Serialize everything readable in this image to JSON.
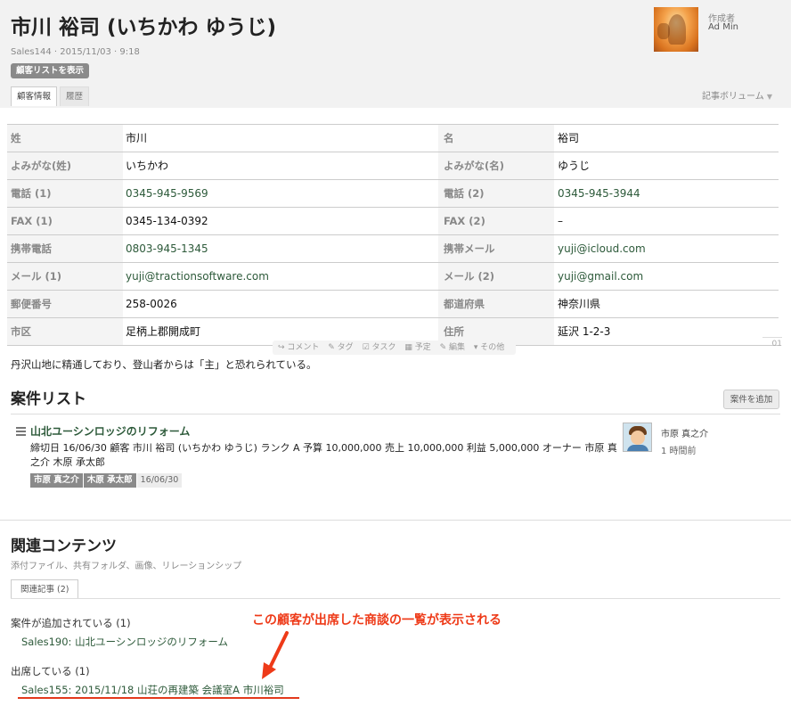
{
  "header": {
    "title": "市川 裕司 (いちかわ ゆうじ)",
    "meta": "Sales144 · 2015/11/03 · 9:18",
    "show_list_button": "顧客リストを表示",
    "author_label": "作成者",
    "author_name": "Ad Min",
    "tabs": [
      {
        "label": "顧客情報",
        "active": true
      },
      {
        "label": "履歴",
        "active": false
      }
    ],
    "volume_label": "記事ボリューム"
  },
  "fields": [
    {
      "label1": "姓",
      "value1": "市川",
      "link1": false,
      "label2": "名",
      "value2": "裕司",
      "link2": false
    },
    {
      "label1": "よみがな(姓)",
      "value1": "いちかわ",
      "link1": false,
      "label2": "よみがな(名)",
      "value2": "ゆうじ",
      "link2": false
    },
    {
      "label1": "電話 (1)",
      "value1": "0345-945-9569",
      "link1": true,
      "label2": "電話 (2)",
      "value2": "0345-945-3944",
      "link2": true
    },
    {
      "label1": "FAX (1)",
      "value1": "0345-134-0392",
      "link1": false,
      "label2": "FAX (2)",
      "value2": "–",
      "link2": false
    },
    {
      "label1": "携帯電話",
      "value1": "0803-945-1345",
      "link1": true,
      "label2": "携帯メール",
      "value2": "yuji@icloud.com",
      "link2": true
    },
    {
      "label1": "メール (1)",
      "value1": "yuji@tractionsoftware.com",
      "link1": true,
      "label2": "メール (2)",
      "value2": "yuji@gmail.com",
      "link2": true
    },
    {
      "label1": "郵便番号",
      "value1": "258-0026",
      "link1": false,
      "label2": "都道府県",
      "value2": "神奈川県",
      "link2": false
    },
    {
      "label1": "市区",
      "value1": "足柄上郡開成町",
      "link1": false,
      "label2": "住所",
      "value2": "延沢 1-2-3",
      "link2": false
    }
  ],
  "actions": {
    "comment": "↪ コメント",
    "tag": "✎ タグ",
    "task": "☑ タスク",
    "schedule": "▦ 予定",
    "edit": "✎ 編集",
    "other": "▾ その他",
    "page_number": "01"
  },
  "description": "丹沢山地に精通しており、登山者からは「主」と恐れられている。",
  "case_section": {
    "title": "案件リスト",
    "add_button": "案件を追加",
    "item": {
      "icon": "list-icon",
      "title": "山北ユーシンロッジのリフォーム",
      "description": "締切日 16/06/30 顧客 市川 裕司 (いちかわ ゆうじ) ランク A 予算 10,000,000 売上 10,000,000 利益 5,000,000 オーナー 市原 真之介 木原 承太郎",
      "tags": [
        "市原 真之介",
        "木原 承太郎"
      ],
      "date_tag": "16/06/30",
      "user_name": "市原 真之介",
      "user_time": "1 時間前"
    }
  },
  "related": {
    "title": "関連コンテンツ",
    "subtitle": "添付ファイル、共有フォルダ、画像、リレーションシップ",
    "tab_label": "関連記事 (2)",
    "groups": [
      {
        "label": "案件が追加されている (1)",
        "link": "Sales190: 山北ユーシンロッジのリフォーム"
      },
      {
        "label": "出席している (1)",
        "link": "Sales155: 2015/11/18 山荘の再建築 会議室A 市川裕司"
      }
    ]
  },
  "annotation": {
    "callout": "この顧客が出席した商談の一覧が表示される",
    "color": "#ee3a18"
  },
  "colors": {
    "link": "#2d5a3a",
    "header_bg": "#f2f2f2",
    "button_gray": "#8a8a8a"
  }
}
